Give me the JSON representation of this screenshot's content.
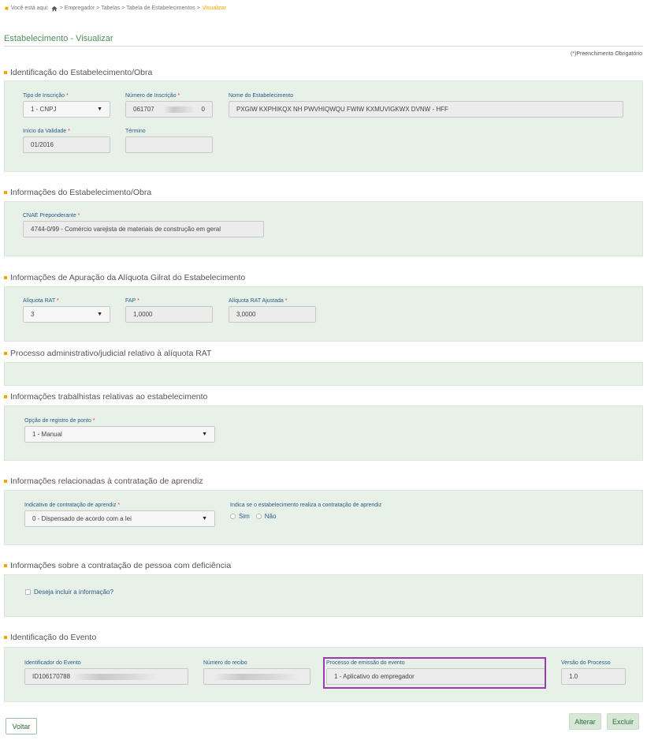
{
  "breadcrumb": {
    "prefix": "Você está aqui:",
    "path": "> Empregador > Tabelas > Tabela de Estabelecimentos >",
    "current": "Visualizar"
  },
  "page": {
    "title": "Estabelecimento - Visualizar",
    "required_note": "(*)Preenchimento Obrigatório"
  },
  "sections": {
    "identificacao": {
      "title": "Identificação do Estabelecimento/Obra",
      "tipo_label": "Tipo de Inscrição",
      "tipo_value": "1 - CNPJ",
      "numero_label": "Número de Inscrição",
      "numero_value_start": "061707",
      "numero_value_end": "0",
      "nome_label": "Nome do Estabelecimento",
      "nome_value": "PXGIW KXPHIKQX NH PWVHIQWQU FWIW KXMUVIGKWX DVNW - HFF",
      "inicio_label": "Início da Validade",
      "inicio_value": "01/2016",
      "termino_label": "Término",
      "termino_value": ""
    },
    "informacoes": {
      "title": "Informações do Estabelecimento/Obra",
      "cnae_label": "CNAE Preponderante",
      "cnae_value": "4744-0/99 - Comércio varejista de materiais de construção em geral"
    },
    "apuracao": {
      "title": "Informações de Apuração da Alíquota Gilrat do Estabelecimento",
      "rat_label": "Alíquota RAT",
      "rat_value": "3",
      "fap_label": "FAP",
      "fap_value": "1,0000",
      "ajustada_label": "Alíquota RAT Ajustada",
      "ajustada_value": "3,0000"
    },
    "processo": {
      "title": "Processo administrativo/judicial relativo à alíquota RAT"
    },
    "trabalhistas": {
      "title": "Informações trabalhistas relativas ao estabelecimento",
      "ponto_label": "Opção de registro de ponto",
      "ponto_value": "1 - Manual"
    },
    "aprendiz": {
      "title": "Informações relacionadas à contratação de aprendiz",
      "indicativo_label": "Indicativo de contratação de aprendiz",
      "indicativo_value": "0 - Dispensado de acordo com a lei",
      "indica_label": "Indica se o estabelecimento realiza a contratação de aprendiz",
      "sim": "Sim",
      "nao": "Não"
    },
    "deficiencia": {
      "title": "Informações sobre a contratação de pessoa com deficiência",
      "checkbox_label": "Deseja incluir a informação?"
    },
    "evento": {
      "title": "Identificação do Evento",
      "id_label": "Identificador do Evento",
      "id_value": "ID106170788",
      "recibo_label": "Número do recibo",
      "recibo_value": "",
      "processo_label": "Processo de emissão do evento",
      "processo_value": "1 - Aplicativo do empregador",
      "versao_label": "Versão do Processo",
      "versao_value": "1.0"
    }
  },
  "buttons": {
    "voltar": "Voltar",
    "alterar": "Alterar",
    "excluir": "Excluir"
  },
  "colors": {
    "accent": "#f0a500",
    "panel": "#e8f1e8",
    "title_green": "#4d8f5a",
    "highlight": "#9b3bb0"
  }
}
